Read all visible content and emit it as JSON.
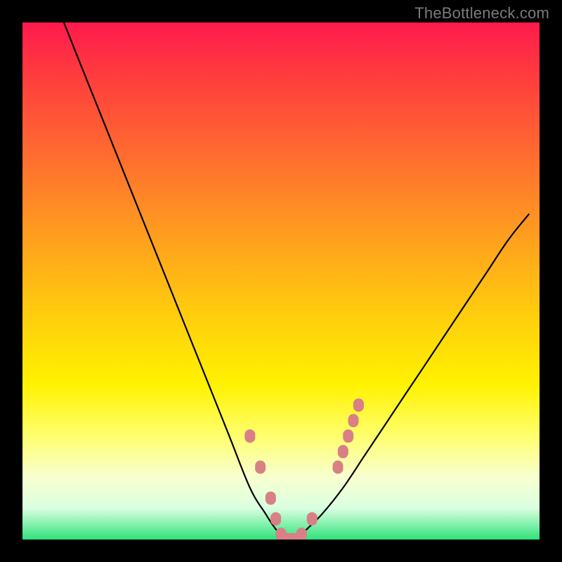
{
  "watermark": "TheBottleneck.com",
  "colors": {
    "frame": "#000000",
    "curve": "#000000",
    "marker": "#d97f86",
    "gradient_top": "#ff1a4d",
    "gradient_bottom": "#2fe27a"
  },
  "chart_data": {
    "type": "line",
    "title": "",
    "xlabel": "",
    "ylabel": "",
    "xlim": [
      0,
      100
    ],
    "ylim": [
      0,
      100
    ],
    "grid": false,
    "series": [
      {
        "name": "bottleneck-curve",
        "x": [
          8,
          12,
          16,
          20,
          24,
          28,
          32,
          36,
          40,
          44,
          47,
          49,
          51,
          53,
          55,
          58,
          62,
          66,
          70,
          74,
          78,
          82,
          86,
          90,
          94,
          98
        ],
        "y": [
          100,
          90,
          80,
          70,
          60,
          50,
          40,
          30,
          20,
          10,
          5,
          2,
          0,
          0,
          2,
          5,
          10,
          16,
          22,
          28,
          34,
          40,
          46,
          52,
          58,
          63
        ]
      }
    ],
    "markers": {
      "name": "highlighted-points",
      "x": [
        44,
        46,
        48,
        49,
        50,
        51,
        52,
        53,
        54,
        56,
        61,
        62,
        63,
        64,
        65
      ],
      "y": [
        20,
        14,
        8,
        4,
        1,
        0,
        0,
        0,
        1,
        4,
        14,
        17,
        20,
        23,
        26
      ]
    }
  }
}
